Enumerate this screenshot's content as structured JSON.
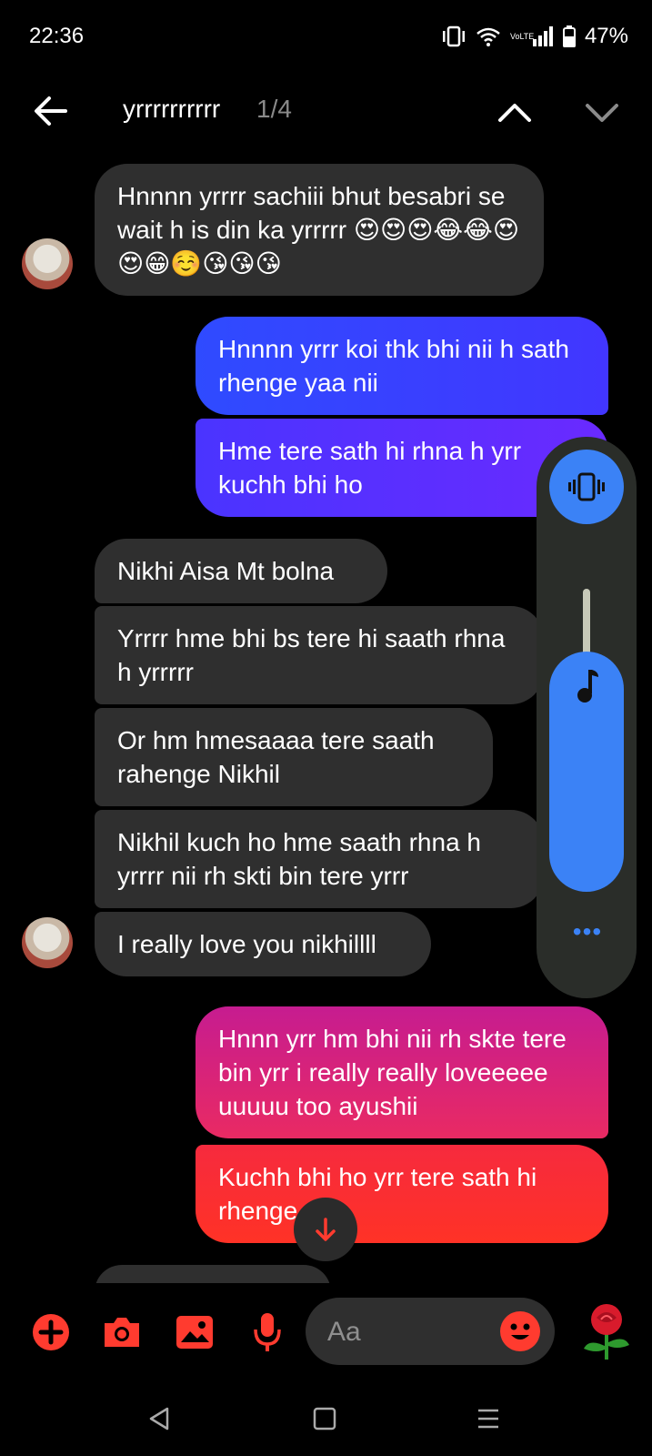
{
  "status_bar": {
    "time": "22:36",
    "battery": "47%",
    "network": "VoLTE"
  },
  "header": {
    "chat_name": "yrrrrrrrrrr",
    "search_count": "1/4"
  },
  "messages": [
    {
      "side": "in",
      "text": "Hnnnn yrrrr sachiii bhut besabri se wait h is din ka yrrrrr",
      "emojis": "😍😍😍😂😂😍😍😁☺️😘😘😘"
    },
    {
      "side": "out",
      "text": "Hnnnn yrrr koi thk bhi nii h sath rhenge yaa nii"
    },
    {
      "side": "out",
      "text": "Hme tere sath hi rhna h yrr kuchh bhi ho"
    },
    {
      "side": "in",
      "text": "Nikhi Aisa Mt bolna"
    },
    {
      "side": "in",
      "text": "Yrrrr hme bhi bs tere hi saath rhna h yrrrrr"
    },
    {
      "side": "in",
      "text": "Or hm hmesaaaa tere saath rahenge Nikhil"
    },
    {
      "side": "in",
      "text": "Nikhil kuch ho hme saath rhna h yrrrr nii rh skti bin tere yrrr"
    },
    {
      "side": "in",
      "text": "I really love you nikhillll"
    },
    {
      "side": "out",
      "text": "Hnnn yrr hm bhi nii rh skte tere bin yrr i really really loveeeee uuuuu too ayushii"
    },
    {
      "side": "out",
      "text": "Kuchh bhi ho yrr tere sath hi rhenge"
    }
  ],
  "composer": {
    "placeholder": "Aa"
  },
  "colors": {
    "incoming_bubble": "#2f2f2f",
    "accent_blue": "#3b82f6",
    "composer_red": "#ff3b2f",
    "gradient_blue": "#3b4cff",
    "gradient_violet": "#5a2bff",
    "gradient_pink": "#c4208e",
    "gradient_red": "#ff3226"
  },
  "volume_panel": {
    "top_icon": "vibrate-icon",
    "slider_icon": "music-note-icon",
    "more_icon": "more-dots-icon"
  }
}
